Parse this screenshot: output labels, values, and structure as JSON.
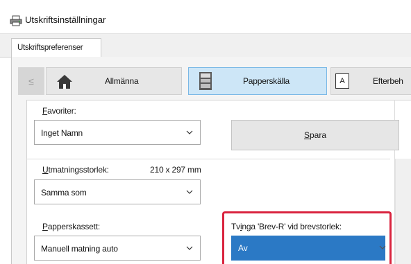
{
  "window": {
    "title": "Utskriftsinställningar",
    "icon": "printer-icon"
  },
  "tabs": [
    {
      "label": "Utskriftspreferenser",
      "selected": true
    }
  ],
  "nav": {
    "prev_label": "≤",
    "buttons": [
      {
        "label": "Allmänna",
        "icon": "home-icon",
        "active": false
      },
      {
        "label": "Papperskälla",
        "icon": "paper-tray-icon",
        "active": true
      },
      {
        "label": "Efterbeh",
        "icon": "document-a-icon",
        "active": false
      }
    ]
  },
  "favorites": {
    "label_access": "F",
    "label_rest": "avoriter:",
    "value": "Inget Namn",
    "save_access": "S",
    "save_rest": "para"
  },
  "output_size": {
    "label_access": "U",
    "label_rest": "tmatningsstorlek:",
    "size_text": "210 x 297 mm",
    "value": "Samma som"
  },
  "paper_tray": {
    "label_access": "P",
    "label_rest": "apperskassett:",
    "value": "Manuell matning auto"
  },
  "force_letter": {
    "label_pre": "Tv",
    "label_access": "i",
    "label_post": "nga 'Brev-R' vid brevstorlek:",
    "value": "Av"
  },
  "colors": {
    "accent": "#2b79c5",
    "highlight": "#d9233e",
    "active_nav": "#cde6f7"
  }
}
